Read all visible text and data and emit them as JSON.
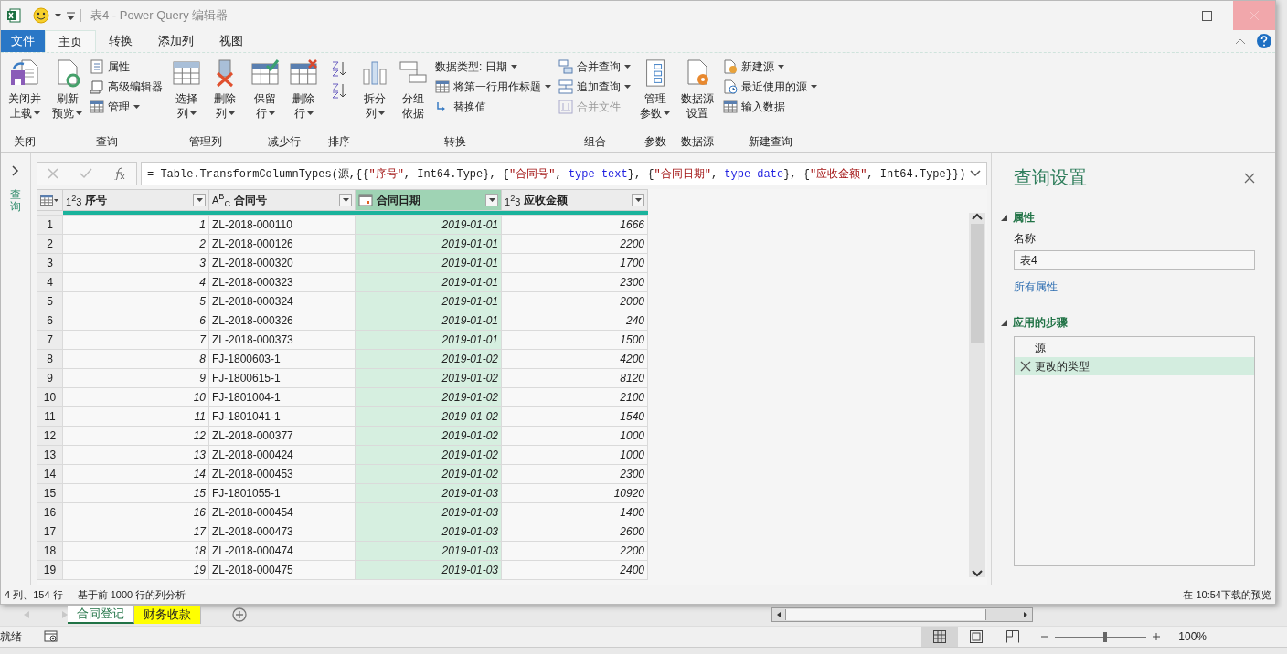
{
  "window": {
    "title": "表4 - Power Query 编辑器"
  },
  "tabs": [
    {
      "label": "文件",
      "kind": "file",
      "selected": false
    },
    {
      "label": "主页",
      "kind": "tab",
      "selected": true
    },
    {
      "label": "转换",
      "kind": "tab",
      "selected": false
    },
    {
      "label": "添加列",
      "kind": "tab",
      "selected": false
    },
    {
      "label": "视图",
      "kind": "tab",
      "selected": false
    }
  ],
  "ribbon": {
    "groups": [
      {
        "label": "关闭",
        "items": [
          {
            "kind": "large",
            "lines": [
              "关闭并",
              "上载"
            ],
            "dropdown": true
          }
        ]
      },
      {
        "label": "查询",
        "items": [
          {
            "kind": "large",
            "lines": [
              "刷新",
              "预览"
            ],
            "dropdown": true
          },
          {
            "kind": "stack",
            "buttons": [
              {
                "label": "属性",
                "dropdown": false,
                "disabled": false
              },
              {
                "label": "高级编辑器",
                "dropdown": false,
                "disabled": false
              },
              {
                "label": "管理",
                "dropdown": true,
                "disabled": false
              }
            ]
          }
        ]
      },
      {
        "label": "管理列",
        "items": [
          {
            "kind": "large",
            "lines": [
              "选择",
              "列"
            ],
            "dropdown": true
          },
          {
            "kind": "large",
            "lines": [
              "删除",
              "列"
            ],
            "dropdown": true
          }
        ]
      },
      {
        "label": "减少行",
        "items": [
          {
            "kind": "large",
            "lines": [
              "保留",
              "行"
            ],
            "dropdown": true
          },
          {
            "kind": "large",
            "lines": [
              "删除",
              "行"
            ],
            "dropdown": true
          }
        ]
      },
      {
        "label": "排序",
        "items": [
          {
            "kind": "sort"
          }
        ]
      },
      {
        "label": "转换",
        "items": [
          {
            "kind": "large",
            "lines": [
              "拆分",
              "列"
            ],
            "dropdown": true
          },
          {
            "kind": "large",
            "lines": [
              "分组",
              "依据"
            ],
            "dropdown": false
          },
          {
            "kind": "stack",
            "buttons": [
              {
                "label": "数据类型: 日期",
                "dropdown": true,
                "disabled": false
              },
              {
                "label": "将第一行用作标题",
                "dropdown": true,
                "disabled": false
              },
              {
                "label": "替换值",
                "dropdown": false,
                "disabled": false
              }
            ]
          }
        ]
      },
      {
        "label": "组合",
        "items": [
          {
            "kind": "stack",
            "buttons": [
              {
                "label": "合并查询",
                "dropdown": true,
                "disabled": false
              },
              {
                "label": "追加查询",
                "dropdown": true,
                "disabled": false
              },
              {
                "label": "合并文件",
                "dropdown": false,
                "disabled": true
              }
            ]
          }
        ]
      },
      {
        "label": "参数",
        "items": [
          {
            "kind": "large",
            "lines": [
              "管理",
              "参数"
            ],
            "dropdown": true
          }
        ]
      },
      {
        "label": "数据源",
        "items": [
          {
            "kind": "large",
            "lines": [
              "数据源",
              "设置"
            ],
            "dropdown": false
          }
        ]
      },
      {
        "label": "新建查询",
        "items": [
          {
            "kind": "stack",
            "buttons": [
              {
                "label": "新建源",
                "dropdown": true,
                "disabled": false
              },
              {
                "label": "最近使用的源",
                "dropdown": true,
                "disabled": false
              },
              {
                "label": "输入数据",
                "dropdown": false,
                "disabled": false
              }
            ]
          }
        ]
      }
    ]
  },
  "sidebar": {
    "label": "查询",
    "expanded": false
  },
  "formula": {
    "tokens": [
      {
        "text": "= Table.TransformColumnTypes(源,{{",
        "kind": "plain"
      },
      {
        "text": "\"序号\"",
        "kind": "string"
      },
      {
        "text": ", Int64.Type}, {",
        "kind": "plain"
      },
      {
        "text": "\"合同号\"",
        "kind": "string"
      },
      {
        "text": ", ",
        "kind": "plain"
      },
      {
        "text": "type text",
        "kind": "keyword"
      },
      {
        "text": "}, {",
        "kind": "plain"
      },
      {
        "text": "\"合同日期\"",
        "kind": "string"
      },
      {
        "text": ", ",
        "kind": "plain"
      },
      {
        "text": "type date",
        "kind": "keyword"
      },
      {
        "text": "}, {",
        "kind": "plain"
      },
      {
        "text": "\"应收金额\"",
        "kind": "string"
      },
      {
        "text": ", Int64.Type}})",
        "kind": "plain"
      }
    ]
  },
  "table": {
    "columns": [
      {
        "label": "序号",
        "kind": "number",
        "type_label": "1$^{2}$3",
        "selected": false
      },
      {
        "label": "合同号",
        "kind": "text",
        "type_label": "A$^{B}$$_{C}$",
        "selected": false
      },
      {
        "label": "合同日期",
        "kind": "date",
        "selected": true
      },
      {
        "label": "应收金额",
        "kind": "number",
        "type_label": "1$^{2}$3",
        "selected": false
      }
    ],
    "rows": [
      {
        "number": "1",
        "cells": [
          "1",
          "ZL-2018-000110",
          "2019-01-01",
          "1666"
        ]
      },
      {
        "number": "2",
        "cells": [
          "2",
          "ZL-2018-000126",
          "2019-01-01",
          "2200"
        ]
      },
      {
        "number": "3",
        "cells": [
          "3",
          "ZL-2018-000320",
          "2019-01-01",
          "1700"
        ]
      },
      {
        "number": "4",
        "cells": [
          "4",
          "ZL-2018-000323",
          "2019-01-01",
          "2300"
        ]
      },
      {
        "number": "5",
        "cells": [
          "5",
          "ZL-2018-000324",
          "2019-01-01",
          "2000"
        ]
      },
      {
        "number": "6",
        "cells": [
          "6",
          "ZL-2018-000326",
          "2019-01-01",
          "240"
        ]
      },
      {
        "number": "7",
        "cells": [
          "7",
          "ZL-2018-000373",
          "2019-01-01",
          "1500"
        ]
      },
      {
        "number": "8",
        "cells": [
          "8",
          "FJ-1800603-1",
          "2019-01-02",
          "4200"
        ]
      },
      {
        "number": "9",
        "cells": [
          "9",
          "FJ-1800615-1",
          "2019-01-02",
          "8120"
        ]
      },
      {
        "number": "10",
        "cells": [
          "10",
          "FJ-1801004-1",
          "2019-01-02",
          "2100"
        ]
      },
      {
        "number": "11",
        "cells": [
          "11",
          "FJ-1801041-1",
          "2019-01-02",
          "1540"
        ]
      },
      {
        "number": "12",
        "cells": [
          "12",
          "ZL-2018-000377",
          "2019-01-02",
          "1000"
        ]
      },
      {
        "number": "13",
        "cells": [
          "13",
          "ZL-2018-000424",
          "2019-01-02",
          "1000"
        ]
      },
      {
        "number": "14",
        "cells": [
          "14",
          "ZL-2018-000453",
          "2019-01-02",
          "2300"
        ]
      },
      {
        "number": "15",
        "cells": [
          "15",
          "FJ-1801055-1",
          "2019-01-03",
          "10920"
        ]
      },
      {
        "number": "16",
        "cells": [
          "16",
          "ZL-2018-000454",
          "2019-01-03",
          "1400"
        ]
      },
      {
        "number": "17",
        "cells": [
          "17",
          "ZL-2018-000473",
          "2019-01-03",
          "2600"
        ]
      },
      {
        "number": "18",
        "cells": [
          "18",
          "ZL-2018-000474",
          "2019-01-03",
          "2200"
        ]
      },
      {
        "number": "19",
        "cells": [
          "19",
          "ZL-2018-000475",
          "2019-01-03",
          "2400"
        ]
      }
    ]
  },
  "settings": {
    "title": "查询设置",
    "properties_heading": "属性",
    "name_label": "名称",
    "name_value": "表4",
    "all_properties_link": "所有属性",
    "steps_heading": "应用的步骤",
    "steps": [
      {
        "label": "源",
        "selected": false
      },
      {
        "label": "更改的类型",
        "selected": true
      }
    ]
  },
  "status_bar": {
    "left": [
      "4 列、154 行",
      "基于前 1000 行的列分析"
    ],
    "right": "在 10:54下载的预览"
  },
  "excel": {
    "sheet_tabs": [
      {
        "label": "合同登记",
        "selected": true
      },
      {
        "label": "财务收款",
        "selected": false,
        "color": "#ffff00"
      }
    ],
    "status": "就绪",
    "views": [
      {
        "selected": true
      },
      {
        "selected": false
      },
      {
        "selected": false
      }
    ],
    "zoom": {
      "level": 0.55,
      "reading": "100%"
    }
  }
}
